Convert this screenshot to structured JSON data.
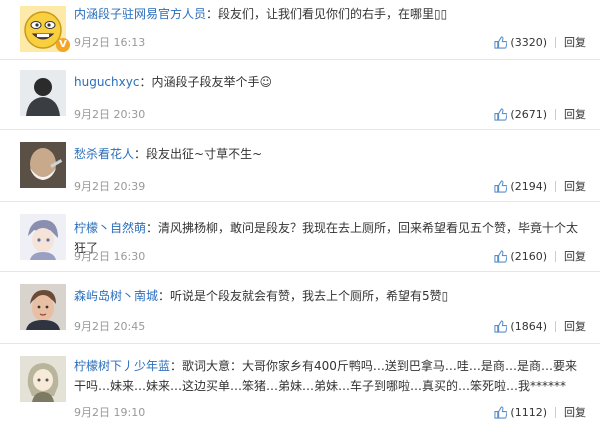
{
  "comments": [
    {
      "user": "内涵段子驻网易官方人员",
      "text": "段友们，让我们看见你们的右手，在哪里▯▯",
      "time": "9月2日 16:13",
      "likes": "(3320)",
      "reply": "回复",
      "avatar_icon": "emoji-face-avatar",
      "verified_badge": "V"
    },
    {
      "user": "huguchxyc",
      "text": "内涵段子段友举个手☺",
      "time": "9月2日 20:30",
      "likes": "(2671)",
      "reply": "回复",
      "avatar_icon": "person-back-avatar"
    },
    {
      "user": "愁杀看花人",
      "text": "段友出征~寸草不生~",
      "time": "9月2日 20:39",
      "likes": "(2194)",
      "reply": "回复",
      "avatar_icon": "shaving-face-avatar"
    },
    {
      "user": "柠檬丶自然萌",
      "text": "清风拂杨柳，敢问是段友？我现在去上厕所，回来希望看见五个赞，毕竟十个太狂了",
      "time": "9月2日 16:30",
      "likes": "(2160)",
      "reply": "回复",
      "avatar_icon": "anime-boy-avatar"
    },
    {
      "user": "森屿岛树丶南城",
      "text": "听说是个段友就会有赞，我去上个厕所，希望有5赞▯",
      "time": "9月2日 20:45",
      "likes": "(1864)",
      "reply": "回复",
      "avatar_icon": "young-man-avatar"
    },
    {
      "user": "柠檬树下丿少年蓝",
      "text": "歌词大意：大哥你家乡有400斤鸭吗…送到巴拿马…哇…是商…是商…要来干吗…妹来…妹来…这边买单…笨猪…弟妹…弟妹…车子到哪啦…真买的…笨死啦…我******",
      "time": "9月2日 19:10",
      "likes": "(1112)",
      "reply": "回复",
      "avatar_icon": "anime-girl-avatar"
    }
  ]
}
